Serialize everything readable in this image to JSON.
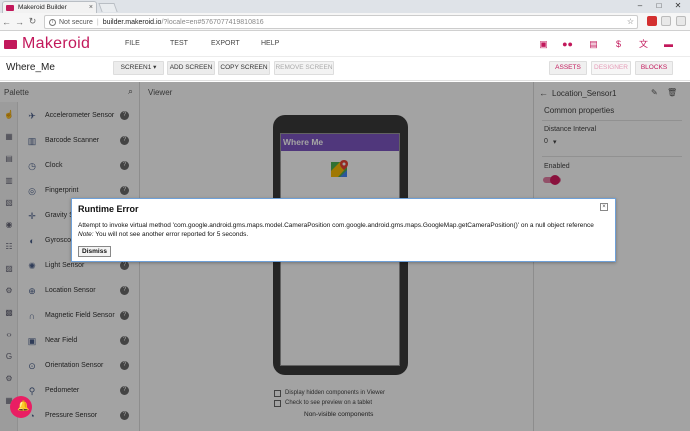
{
  "browser": {
    "tab_title": "Makeroid Builder",
    "tab_close": "×",
    "security_text": "Not secure",
    "separator": "|",
    "url_host": "builder.makeroid.io",
    "url_path": "/?locale=en#5767077419810816",
    "back": "←",
    "forward": "→",
    "reload": "↻",
    "star": "☆",
    "win_min": "–",
    "win_max": "□",
    "win_close": "✕",
    "info_glyph": "i"
  },
  "app": {
    "name": "Makeroid",
    "menu": [
      "FILE",
      "TEST",
      "EXPORT",
      "HELP"
    ],
    "brand_color": "#c2185b"
  },
  "project": {
    "name": "Where_Me",
    "screen_btn": "SCREEN1 ▾",
    "add_screen": "ADD SCREEN",
    "copy_screen": "COPY SCREEN",
    "remove_screen": "REMOVE SCREEN",
    "assets": "ASSETS",
    "designer": "DESIGNER",
    "blocks": "BLOCKS"
  },
  "palette": {
    "title": "Palette",
    "search_icon": "⌕",
    "help_glyph": "?",
    "items": [
      {
        "label": "Accelerometer Sensor",
        "icon": "rocket-icon",
        "glyph": "✈"
      },
      {
        "label": "Barcode Scanner",
        "icon": "barcode-icon",
        "glyph": "▥"
      },
      {
        "label": "Clock",
        "icon": "clock-icon",
        "glyph": "◷"
      },
      {
        "label": "Fingerprint",
        "icon": "fingerprint-icon",
        "glyph": "◎"
      },
      {
        "label": "Gravity Sensor",
        "icon": "gravity-icon",
        "glyph": "✛"
      },
      {
        "label": "Gyroscope Sensor",
        "icon": "gyroscope-icon",
        "glyph": "◐"
      },
      {
        "label": "Light Sensor",
        "icon": "light-icon",
        "glyph": "✺"
      },
      {
        "label": "Location Sensor",
        "icon": "location-icon",
        "glyph": "⊕"
      },
      {
        "label": "Magnetic Field Sensor",
        "icon": "magnet-icon",
        "glyph": "∩"
      },
      {
        "label": "Near Field",
        "icon": "nfc-icon",
        "glyph": "▣"
      },
      {
        "label": "Orientation Sensor",
        "icon": "compass-icon",
        "glyph": "⊙"
      },
      {
        "label": "Pedometer",
        "icon": "pedometer-icon",
        "glyph": "⚲"
      },
      {
        "label": "Pressure Sensor",
        "icon": "pressure-icon",
        "glyph": "◔"
      }
    ]
  },
  "viewer": {
    "title": "Viewer",
    "screen_title": "Where Me",
    "hidden_components_label": "Display hidden components in Viewer",
    "tablet_label": "Check to see preview on a tablet",
    "nonvisible_label": "Non-visible components"
  },
  "properties": {
    "component": "Location_Sensor1",
    "back": "←",
    "edit": "✎",
    "delete": "🗑",
    "section": "Common properties",
    "distance_label": "Distance Interval",
    "distance_value": "0",
    "distance_dd": "▾",
    "enabled_label": "Enabled"
  },
  "dialog": {
    "title": "Runtime Error",
    "close": "×",
    "message": "Attempt to invoke virtual method 'com.google.android.gms.maps.model.CameraPosition com.google.android.gms.maps.GoogleMap.getCameraPosition()' on a null object reference",
    "note_label": "Note:",
    "note_text": " You will not see another error reported for 5 seconds.",
    "dismiss": "Dismiss"
  },
  "notification": {
    "glyph": "🔔"
  }
}
